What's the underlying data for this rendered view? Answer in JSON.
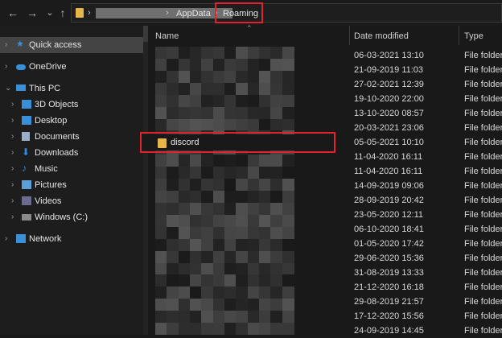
{
  "address_bar": {
    "breadcrumbs": [
      "AppData",
      "Roaming"
    ],
    "separator": "›"
  },
  "nav_buttons": {
    "back": "←",
    "forward": "→",
    "recent": "⌄",
    "up": "↑"
  },
  "sidebar": {
    "items": [
      {
        "label": "Quick access",
        "icon": "star-icon",
        "color": "#3a8fd9"
      },
      {
        "label": "OneDrive",
        "icon": "cloud-icon",
        "color": "#3a8fd9"
      },
      {
        "label": "This PC",
        "icon": "computer-icon",
        "color": "#3a8fd9"
      },
      {
        "label": "3D Objects",
        "icon": "cube-icon",
        "color": "#3a8fd9"
      },
      {
        "label": "Desktop",
        "icon": "desktop-icon",
        "color": "#3a8fd9"
      },
      {
        "label": "Documents",
        "icon": "document-icon",
        "color": "#9ab0c8"
      },
      {
        "label": "Downloads",
        "icon": "download-icon",
        "color": "#2f8ae0"
      },
      {
        "label": "Music",
        "icon": "music-icon",
        "color": "#2f8ae0"
      },
      {
        "label": "Pictures",
        "icon": "picture-icon",
        "color": "#5d9ed6"
      },
      {
        "label": "Videos",
        "icon": "video-icon",
        "color": "#6b6b8f"
      },
      {
        "label": "Windows (C:)",
        "icon": "drive-icon",
        "color": "#8a8a8a"
      },
      {
        "label": "Network",
        "icon": "network-icon",
        "color": "#3a8fd9"
      }
    ]
  },
  "columns": {
    "name": "Name",
    "date_modified": "Date modified",
    "type": "Type"
  },
  "highlighted_folder": "discord",
  "rows": [
    {
      "date": "06-03-2021 13:10",
      "type": "File folder"
    },
    {
      "date": "21-09-2019 11:03",
      "type": "File folder"
    },
    {
      "date": "27-02-2021 12:39",
      "type": "File folder"
    },
    {
      "date": "19-10-2020 22:00",
      "type": "File folder"
    },
    {
      "date": "13-10-2020 08:57",
      "type": "File folder"
    },
    {
      "date": "20-03-2021 23:06",
      "type": "File folder"
    },
    {
      "date": "05-05-2021 10:10",
      "type": "File folder"
    },
    {
      "date": "11-04-2020 16:11",
      "type": "File folder"
    },
    {
      "date": "11-04-2020 16:11",
      "type": "File folder"
    },
    {
      "date": "14-09-2019 09:06",
      "type": "File folder"
    },
    {
      "date": "28-09-2019 20:42",
      "type": "File folder"
    },
    {
      "date": "23-05-2020 12:11",
      "type": "File folder"
    },
    {
      "date": "06-10-2020 18:41",
      "type": "File folder"
    },
    {
      "date": "01-05-2020 17:42",
      "type": "File folder"
    },
    {
      "date": "29-06-2020 15:36",
      "type": "File folder"
    },
    {
      "date": "31-08-2019 13:33",
      "type": "File folder"
    },
    {
      "date": "21-12-2020 16:18",
      "type": "File folder"
    },
    {
      "date": "29-08-2019 21:57",
      "type": "File folder"
    },
    {
      "date": "17-12-2020 15:56",
      "type": "File folder"
    },
    {
      "date": "24-09-2019 14:45",
      "type": "File folder"
    }
  ]
}
